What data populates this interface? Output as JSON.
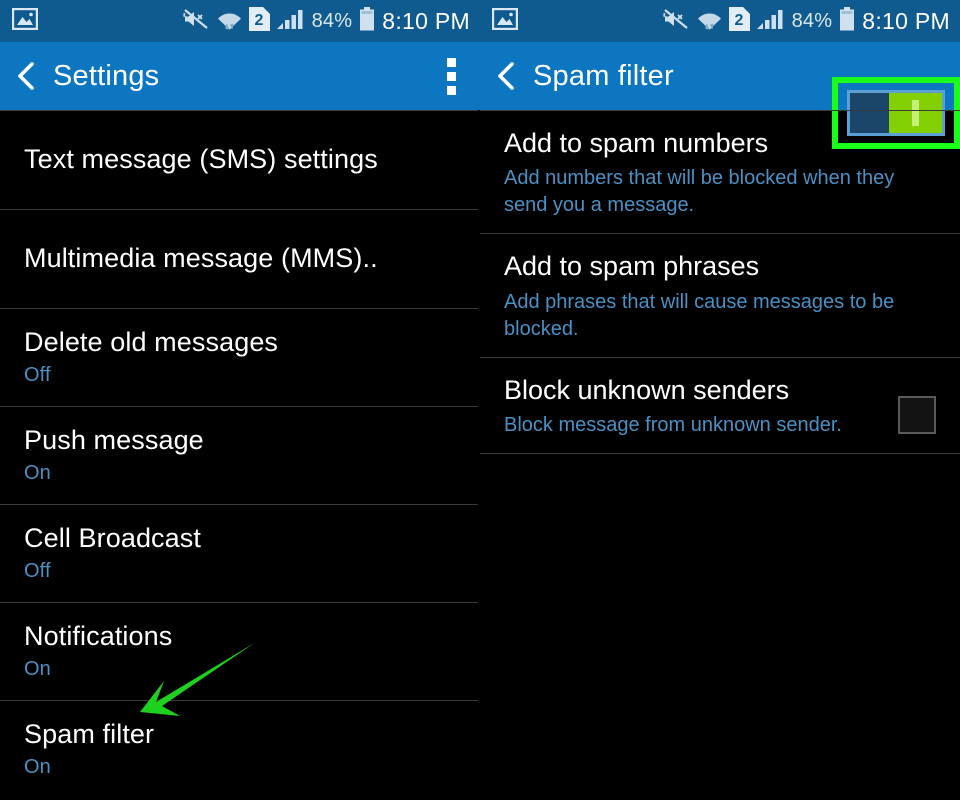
{
  "status_bar": {
    "battery_percent": "84%",
    "time": "8:10 PM",
    "icons": [
      "screenshot-image-icon",
      "mute-vibrate-off-icon",
      "wifi-icon",
      "sim-2-icon",
      "signal-bars-icon",
      "battery-icon"
    ],
    "sim_label": "2"
  },
  "left_panel": {
    "header": {
      "title": "Settings",
      "back_icon": "back-chevron-icon",
      "overflow_icon": "overflow-menu-icon"
    },
    "items": [
      {
        "title": "Text message (SMS) settings",
        "sub": ""
      },
      {
        "title": "Multimedia message (MMS)..",
        "sub": ""
      },
      {
        "title": "Delete old messages",
        "sub": "Off"
      },
      {
        "title": "Push message",
        "sub": "On"
      },
      {
        "title": "Cell Broadcast",
        "sub": "Off"
      },
      {
        "title": "Notifications",
        "sub": "On"
      },
      {
        "title": "Spam filter",
        "sub": "On"
      }
    ]
  },
  "right_panel": {
    "header": {
      "title": "Spam filter",
      "back_icon": "back-chevron-icon",
      "toggle_state": "on",
      "highlight_color": "#1aff1a"
    },
    "items": [
      {
        "title": "Add to spam numbers",
        "sub": "Add numbers that will be blocked when they send you a message.",
        "has_checkbox": false
      },
      {
        "title": "Add to spam phrases",
        "sub": "Add phrases that will cause messages to be blocked.",
        "has_checkbox": false
      },
      {
        "title": "Block unknown senders",
        "sub": "Block message from unknown sender.",
        "has_checkbox": true,
        "checked": false
      }
    ]
  },
  "annotation": {
    "arrow_color": "#1ed11e",
    "arrow_points_to": "Spam filter"
  },
  "colors": {
    "status_bar": "#0f5a8e",
    "action_bar": "#0d76c1",
    "background": "#000000",
    "title_text": "#ffffff",
    "sub_text": "#4a90c4",
    "divider": "#3a3a3a",
    "toggle_on": "#83d105",
    "highlight": "#1aff1a"
  }
}
